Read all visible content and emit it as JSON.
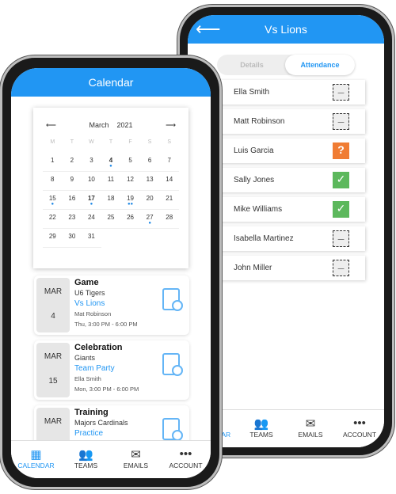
{
  "accent": "#2196f3",
  "attendance": {
    "title": "Vs Lions",
    "back_icon": "arrow-left-icon",
    "tabs": [
      "Details",
      "Attendance"
    ],
    "active_tab": "Attendance",
    "players": [
      {
        "name": "Ella Smith",
        "status": "none",
        "glyph": "–"
      },
      {
        "name": "Matt Robinson",
        "status": "none",
        "glyph": "–"
      },
      {
        "name": "Luis Garcia",
        "status": "maybe",
        "glyph": "?"
      },
      {
        "name": "Sally Jones",
        "status": "yes",
        "glyph": "✓"
      },
      {
        "name": "Mike Williams",
        "status": "yes",
        "glyph": "✓"
      },
      {
        "name": "Isabella Martinez",
        "status": "none",
        "glyph": "–"
      },
      {
        "name": "John Miller",
        "status": "none",
        "glyph": "–"
      }
    ]
  },
  "nav": [
    {
      "label": "CALENDAR",
      "icon": "calendar-icon",
      "glyph": "▦"
    },
    {
      "label": "TEAMS",
      "icon": "users-icon",
      "glyph": "👥"
    },
    {
      "label": "EMAILS",
      "icon": "mail-icon",
      "glyph": "✉"
    },
    {
      "label": "ACCOUNT",
      "icon": "more-icon",
      "glyph": "•••"
    }
  ],
  "calendar": {
    "title": "Calendar",
    "month": "March",
    "year": "2021",
    "weekdays": [
      "M",
      "T",
      "W",
      "T",
      "F",
      "S",
      "S"
    ],
    "days": [
      1,
      2,
      3,
      4,
      5,
      6,
      7,
      8,
      9,
      10,
      11,
      12,
      13,
      14,
      15,
      16,
      17,
      18,
      19,
      20,
      21,
      22,
      23,
      24,
      25,
      26,
      27,
      28,
      29,
      30,
      31
    ],
    "event_dots": {
      "4": 1,
      "15": 1,
      "17": 1,
      "19": 2,
      "27": 1
    },
    "events": [
      {
        "month": "MAR",
        "day": "4",
        "type": "Game",
        "team": "U6 Tigers",
        "name": "Vs Lions",
        "person": "Mat Robinson",
        "time": "Thu, 3:00 PM - 6:00 PM"
      },
      {
        "month": "MAR",
        "day": "15",
        "type": "Celebration",
        "team": "Giants",
        "name": "Team Party",
        "person": "Ella Smith",
        "time": "Mon, 3:00 PM - 6:00 PM"
      },
      {
        "month": "MAR",
        "day": "",
        "type": "Training",
        "team": "Majors Cardinals",
        "name": "Practice",
        "person": "",
        "time": ""
      }
    ]
  }
}
